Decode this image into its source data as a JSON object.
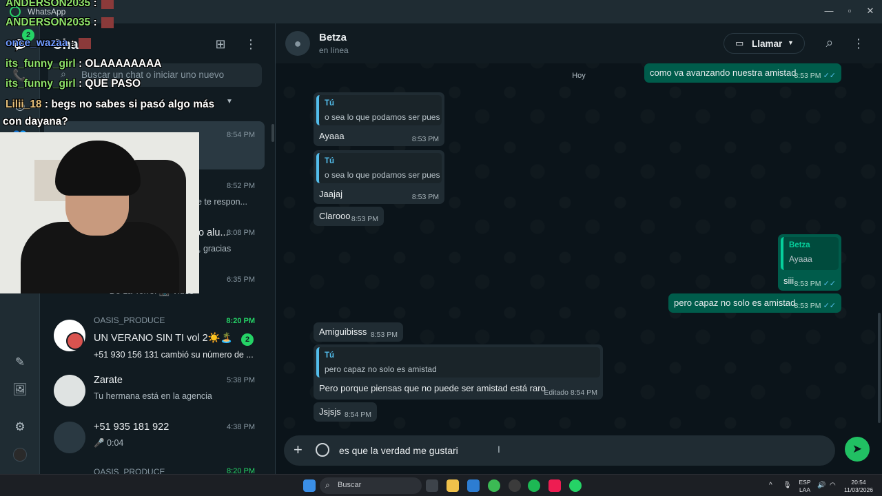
{
  "window": {
    "title": "WhatsApp"
  },
  "rail": {
    "badge_count": "2"
  },
  "sidebar": {
    "title": "Chat",
    "search_placeholder": "Buscar un chat o iniciar uno nuevo",
    "chats": [
      {
        "name": "",
        "time": "8:54 PM",
        "preview": ""
      },
      {
        "name": "",
        "time": "8:52 PM",
        "preview": "e te respon..."
      },
      {
        "name": "o alu...",
        "time": "8:08 PM",
        "preview": ", gracias"
      },
      {
        "name": "",
        "time": "6:35 PM",
        "preview": "~ De La Torre: 📷 Video"
      },
      {
        "group": "OASIS_PRODUCE",
        "name": "UN VERANO SIN TI vol 2☀️🏝️",
        "time": "8:20 PM",
        "preview": "+51 930 156 131 cambió su número de ...",
        "unread": "2"
      },
      {
        "name": "Zarate",
        "time": "5:38 PM",
        "preview": "Tu hermana está en la agencia"
      },
      {
        "name": "+51 935 181 922",
        "time": "4:38 PM",
        "preview": "🎤 0:04"
      },
      {
        "name": "OASIS_PRODUCE",
        "time": "8:20 PM",
        "preview": ""
      }
    ]
  },
  "chat": {
    "contact_name": "Betza",
    "contact_status": "en línea",
    "call_label": "Llamar",
    "date_chip": "Hoy",
    "messages": [
      {
        "dir": "out",
        "text": "como va avanzando nuestra amistad",
        "time": "8:53 PM"
      },
      {
        "dir": "in",
        "quote_author": "Tú",
        "quote_text": "o sea lo que podamos ser pues",
        "text": "Ayaaa",
        "time": "8:53 PM"
      },
      {
        "dir": "in",
        "quote_author": "Tú",
        "quote_text": "o sea lo que podamos ser pues",
        "text": "Jaajaj",
        "time": "8:53 PM"
      },
      {
        "dir": "in",
        "text": "Clarooo",
        "time": "8:53 PM"
      },
      {
        "dir": "out",
        "quote_author": "Betza",
        "quote_text": "Ayaaa",
        "text": "siii",
        "time": "8:53 PM"
      },
      {
        "dir": "out",
        "text": "pero capaz no solo es amistad",
        "time": "8:53 PM"
      },
      {
        "dir": "in",
        "text": "Amiguibisss",
        "time": "8:53 PM"
      },
      {
        "dir": "in",
        "quote_author": "Tú",
        "quote_text": "pero capaz no solo es amistad",
        "text": "Pero porque piensas que no puede ser amistad está raro",
        "time": "Editado 8:54 PM"
      },
      {
        "dir": "in",
        "text": "Jsjsjs",
        "time": "8:54 PM"
      }
    ],
    "composer_value": "es que la verdad me gustari"
  },
  "stream_overlay": [
    {
      "user": "ANDERSON2035",
      "text": " :",
      "color": "#8fe36b"
    },
    {
      "user": "ANDERSON2035",
      "text": " :",
      "color": "#8fe36b"
    },
    {
      "user": "once_wazaa",
      "text": " :",
      "color": "#6f9bff"
    },
    {
      "user": "its_funny_girl",
      "text": " : OLAAAAAAAA",
      "color": "#8fe36b"
    },
    {
      "user": "its_funny_girl",
      "text": " : QUE PASO",
      "color": "#8fe36b"
    },
    {
      "user": "Lilii_18",
      "text": " : begs no sabes si pasó algo más",
      "color": "#e6c07b"
    },
    {
      "user": "",
      "text": "con dayana?",
      "color": "#ffffff"
    }
  ],
  "taskbar": {
    "search_label": "Buscar",
    "language_top": "ESP",
    "language_bottom": "LAA",
    "clock_time": "20:54",
    "clock_date": "11/03/2026"
  },
  "colors": {
    "accent": "#25d366",
    "outgoing": "#005c4b",
    "incoming": "#202c33",
    "panel": "#111b21"
  }
}
